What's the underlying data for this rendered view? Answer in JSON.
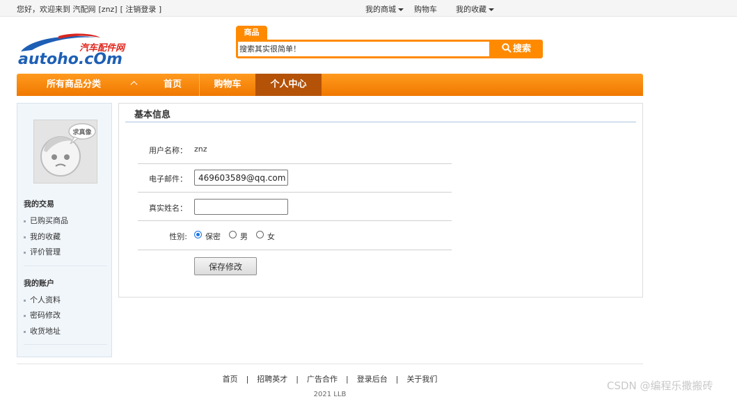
{
  "topbar": {
    "greeting": "您好，欢迎来到 汽配网",
    "user": "[znz]",
    "logout": "[ 注销登录 ]",
    "menu_mall": "我的商城",
    "menu_cart": "购物车",
    "menu_fav": "我的收藏"
  },
  "logo": {
    "cn": "汽车配件网",
    "en": "autoho.cOm"
  },
  "search": {
    "tab": "商品",
    "placeholder": "搜索其实很简单！",
    "button": "搜索"
  },
  "mainnav": {
    "categories": "所有商品分类",
    "items": [
      "首页",
      "购物车",
      "个人中心"
    ],
    "active": "个人中心"
  },
  "sidebar": {
    "avatar_text": "求真像",
    "section1_title": "我的交易",
    "section1_items": [
      "已购买商品",
      "我的收藏",
      "评价管理"
    ],
    "section2_title": "我的账户",
    "section2_items": [
      "个人资料",
      "密码修改",
      "收货地址"
    ]
  },
  "content": {
    "title": "基本信息",
    "username_label": "用户名称：",
    "username_value": "znz",
    "email_label": "电子邮件：",
    "email_value": "469603589@qq.com",
    "realname_label": "真实姓名：",
    "realname_value": "",
    "gender_label": "性别:",
    "gender_options": [
      "保密",
      "男",
      "女"
    ],
    "gender_selected": "保密",
    "save_button": "保存修改"
  },
  "footer": {
    "links": [
      "首页",
      "招聘英才",
      "广告合作",
      "登录后台",
      "关于我们"
    ],
    "separator": "|",
    "copyright": "2021 LLB"
  },
  "watermark": "CSDN @编程乐撒搬砖",
  "colors": {
    "accent": "#ff8a00",
    "nav_active": "#b45208",
    "sidebar_bg": "#f1f6fb",
    "radio_on": "#1a73e8"
  }
}
